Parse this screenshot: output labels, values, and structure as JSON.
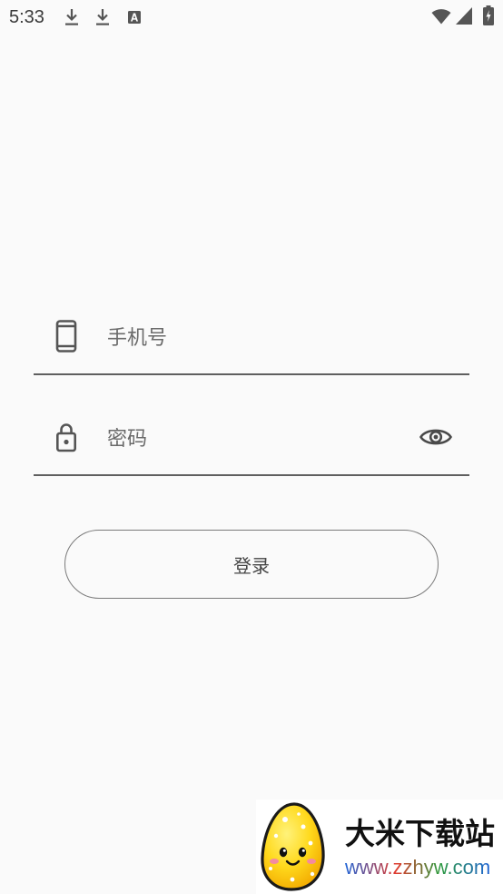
{
  "status_bar": {
    "time": "5:33",
    "notification_icons": [
      "download-icon",
      "download-icon",
      "text-a-icon"
    ],
    "system_icons": [
      "wifi-icon",
      "signal-icon",
      "battery-icon"
    ]
  },
  "login_form": {
    "phone_field": {
      "icon": "phone-icon",
      "placeholder": "手机号",
      "value": ""
    },
    "password_field": {
      "icon": "lock-icon",
      "placeholder": "密码",
      "value": "",
      "visibility_toggle_icon": "eye-icon"
    },
    "login_button": {
      "label": "登录"
    }
  },
  "watermark": {
    "logo": "rice-mascot-logo",
    "site_name": "大米下载站",
    "site_url": "www.zzhyw.com"
  },
  "colors": {
    "background": "#fafafa",
    "icon": "#555555",
    "placeholder_text": "#6a6a6a",
    "underline": "#5f5f5f",
    "button_border": "#7a7a7a",
    "button_text": "#444444"
  }
}
